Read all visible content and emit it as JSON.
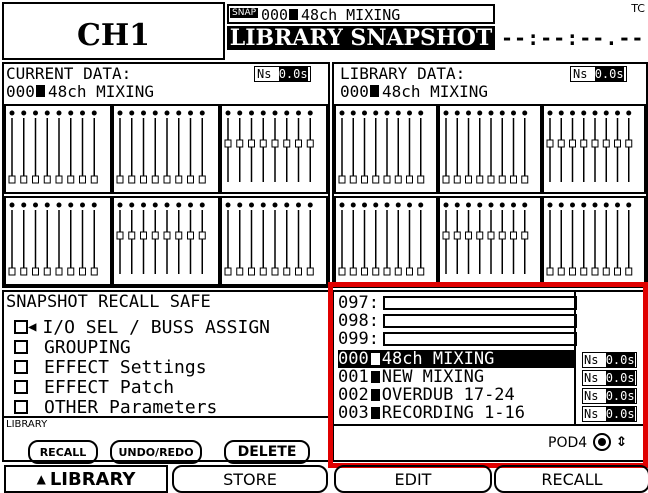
{
  "header": {
    "channel": "CH1",
    "snap_tag": "SNAP",
    "snap_id": "000",
    "snap_name": "48ch MIXING",
    "screen_title": "LIBRARY SNAPSHOT",
    "top_right": "TC",
    "timecode": "--:--:--.--"
  },
  "current": {
    "label": "CURRENT DATA:",
    "ns": "Ns",
    "time": "0.0s",
    "name_id": "000",
    "name": "48ch MIXING"
  },
  "library_data": {
    "label": "LIBRARY DATA:",
    "ns": "Ns",
    "time": "0.0s",
    "name_id": "000",
    "name": "48ch MIXING"
  },
  "recall_safe": {
    "title": "SNAPSHOT RECALL SAFE",
    "items": [
      "I/O SEL / BUSS ASSIGN",
      "GROUPING",
      "EFFECT Settings",
      "EFFECT Patch",
      "OTHER Parameters"
    ]
  },
  "library_panel": {
    "label": "LIBRARY",
    "recall": "RECALL",
    "undo_redo": "UNDO/REDO",
    "delete": "DELETE"
  },
  "library_list": {
    "empty_rows": [
      "097:",
      "098:",
      "099:"
    ],
    "rows": [
      {
        "id": "000",
        "name": "48ch MIXING",
        "ns": "Ns",
        "time": "0.0s",
        "selected": true
      },
      {
        "id": "001",
        "name": "NEW MIXING",
        "ns": "Ns",
        "time": "0.0s",
        "selected": false
      },
      {
        "id": "002",
        "name": "OVERDUB 17-24",
        "ns": "Ns",
        "time": "0.0s",
        "selected": false
      },
      {
        "id": "003",
        "name": "RECORDING 1-16",
        "ns": "Ns",
        "time": "0.0s",
        "selected": false
      }
    ],
    "pod": "POD4"
  },
  "tabs": {
    "library": "LIBRARY",
    "store": "STORE",
    "edit": "EDIT",
    "recall": "RECALL"
  },
  "colors": {
    "highlight": "#e00000"
  }
}
